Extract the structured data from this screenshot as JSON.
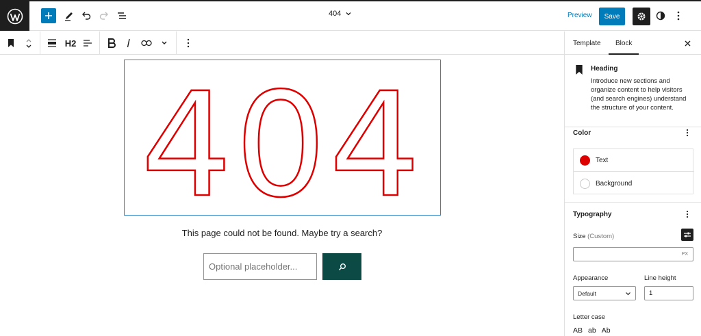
{
  "header": {
    "document_title": "404",
    "preview_label": "Preview",
    "save_label": "Save"
  },
  "toolbar": {
    "heading_level": "H2"
  },
  "canvas": {
    "heading_text": "404",
    "heading_color": "#dd0000",
    "message": "This page could not be found. Maybe try a search?",
    "search": {
      "placeholder": "Optional placeholder...",
      "button_color": "#0b4a45"
    }
  },
  "sidebar": {
    "tabs": [
      {
        "label": "Template"
      },
      {
        "label": "Block",
        "active": true
      }
    ],
    "block_card": {
      "title": "Heading",
      "description": "Introduce new sections and organize content to help visitors (and search engines) understand the structure of your content."
    },
    "color_panel": {
      "title": "Color",
      "items": [
        {
          "label": "Text",
          "color": "#dd0000"
        },
        {
          "label": "Background",
          "color": "#ffffff"
        }
      ]
    },
    "typography_panel": {
      "title": "Typography",
      "size_label": "Size",
      "size_hint": "(Custom)",
      "size_value": "",
      "size_unit": "PX",
      "appearance_label": "Appearance",
      "appearance_value": "Default",
      "line_height_label": "Line height",
      "line_height_value": "1",
      "letter_case_label": "Letter case",
      "letter_case_options": [
        "AB",
        "ab",
        "Ab"
      ]
    }
  },
  "colors": {
    "accent": "#007cba",
    "dark": "#1e1e1e",
    "selection_border": "#3582c4"
  }
}
